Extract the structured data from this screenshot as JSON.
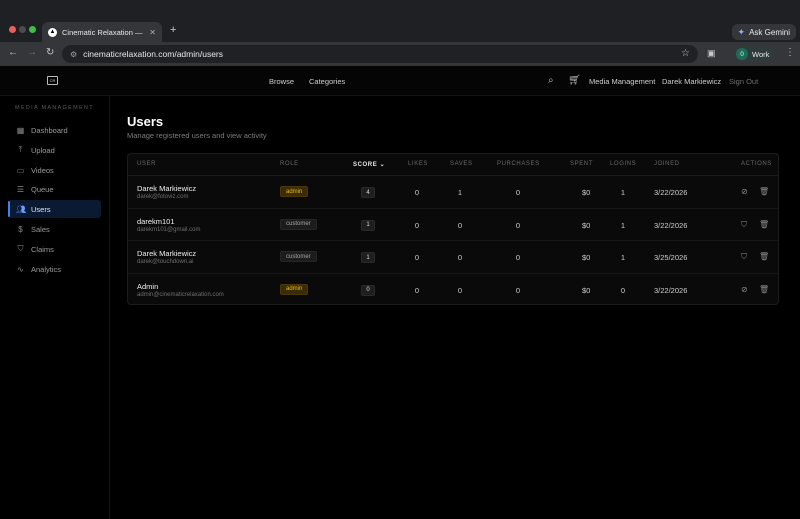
{
  "browser": {
    "tab_title": "Cinematic Relaxation — Prem",
    "tab_favicon": "▲",
    "tab_close": "✕",
    "new_tab": "+",
    "gemini_label": "Ask Gemini",
    "url": "cinematicrelaxation.com/admin/users",
    "profile_initial": "0",
    "profile_label": "Work"
  },
  "header": {
    "logo": "CR",
    "nav": [
      "Browse",
      "Categories"
    ],
    "media_management": "Media Management",
    "user_name": "Darek Markiewicz",
    "sign_out": "Sign Out"
  },
  "sidebar": {
    "heading": "MEDIA MANAGEMENT",
    "items": [
      {
        "label": "Dashboard",
        "icon": "grid-icon"
      },
      {
        "label": "Upload",
        "icon": "upload-icon"
      },
      {
        "label": "Videos",
        "icon": "video-icon"
      },
      {
        "label": "Queue",
        "icon": "queue-icon"
      },
      {
        "label": "Users",
        "icon": "users-icon",
        "active": true
      },
      {
        "label": "Sales",
        "icon": "dollar-icon"
      },
      {
        "label": "Claims",
        "icon": "shield-icon"
      },
      {
        "label": "Analytics",
        "icon": "chart-icon"
      }
    ]
  },
  "page": {
    "title": "Users",
    "subtitle": "Manage registered users and view activity"
  },
  "table": {
    "columns": {
      "user": "USER",
      "role": "ROLE",
      "score": "SCORE",
      "likes": "LIKES",
      "saves": "SAVES",
      "purchases": "PURCHASES",
      "spent": "SPENT",
      "logins": "LOGINS",
      "joined": "JOINED",
      "actions": "ACTIONS"
    },
    "sorted_by": "score",
    "rows": [
      {
        "name": "Darek Markiewicz",
        "email": "darek@fotoviz.com",
        "role": "admin",
        "score": "4",
        "likes": "0",
        "saves": "1",
        "purchases": "0",
        "spent": "$0",
        "logins": "1",
        "joined": "3/22/2026"
      },
      {
        "name": "darekm101",
        "email": "darekm101@gmail.com",
        "role": "customer",
        "score": "1",
        "likes": "0",
        "saves": "0",
        "purchases": "0",
        "spent": "$0",
        "logins": "1",
        "joined": "3/22/2026"
      },
      {
        "name": "Darek Markiewicz",
        "email": "darek@touchdown.ai",
        "role": "customer",
        "score": "1",
        "likes": "0",
        "saves": "0",
        "purchases": "0",
        "spent": "$0",
        "logins": "1",
        "joined": "3/25/2026"
      },
      {
        "name": "Admin",
        "email": "admin@cinematicrelaxation.com",
        "role": "admin",
        "score": "0",
        "likes": "0",
        "saves": "0",
        "purchases": "0",
        "spent": "$0",
        "logins": "0",
        "joined": "3/22/2026"
      }
    ]
  }
}
